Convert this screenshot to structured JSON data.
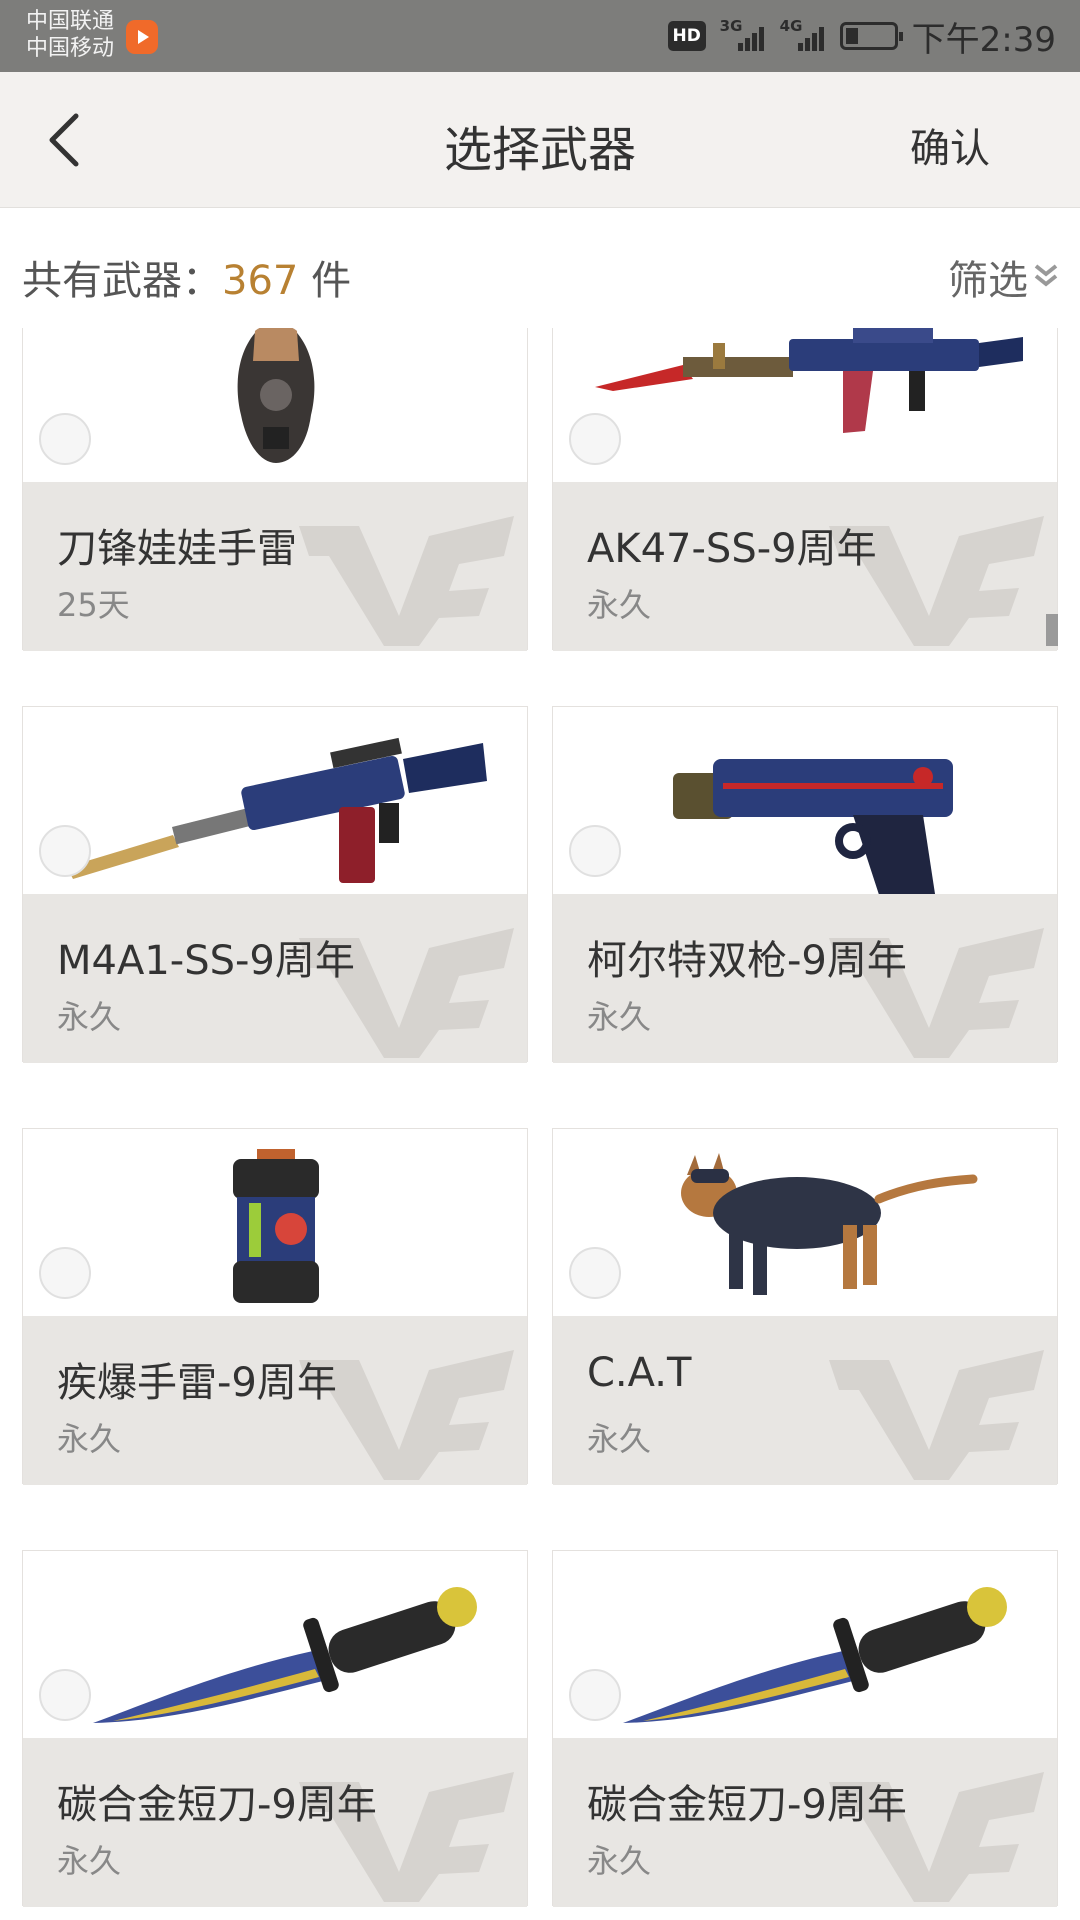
{
  "status_bar": {
    "carrier_1": "中国联通",
    "carrier_2": "中国移动",
    "hd": "HD",
    "net_1": "3G",
    "net_2": "4G",
    "battery_level": 0.25,
    "time": "下午2:39"
  },
  "nav": {
    "title": "选择武器",
    "confirm_label": "确认"
  },
  "summary": {
    "count_label": "共有武器：",
    "count_value": "367",
    "count_unit": " 件",
    "filter_label": "筛选"
  },
  "weapons": [
    {
      "name": "刀锋娃娃手雷",
      "duration": "25天",
      "icon": "grenade-doll-icon"
    },
    {
      "name": "AK47-SS-9周年",
      "duration": "永久",
      "icon": "rifle-ak47-icon"
    },
    {
      "name": "M4A1-SS-9周年",
      "duration": "永久",
      "icon": "rifle-m4a1-icon"
    },
    {
      "name": "柯尔特双枪-9周年",
      "duration": "永久",
      "icon": "pistol-colt-icon"
    },
    {
      "name": "疾爆手雷-9周年",
      "duration": "永久",
      "icon": "grenade-canister-icon"
    },
    {
      "name": "C.A.T",
      "duration": "永久",
      "icon": "cat-icon"
    },
    {
      "name": "碳合金短刀-9周年",
      "duration": "永久",
      "icon": "knife-icon"
    },
    {
      "name": "碳合金短刀-9周年",
      "duration": "永久",
      "icon": "knife-icon"
    }
  ],
  "colors": {
    "status_bg": "#7d7d7b",
    "nav_bg": "#f3f1ef",
    "accent": "#b88132",
    "card_info_bg": "#e8e6e3"
  }
}
